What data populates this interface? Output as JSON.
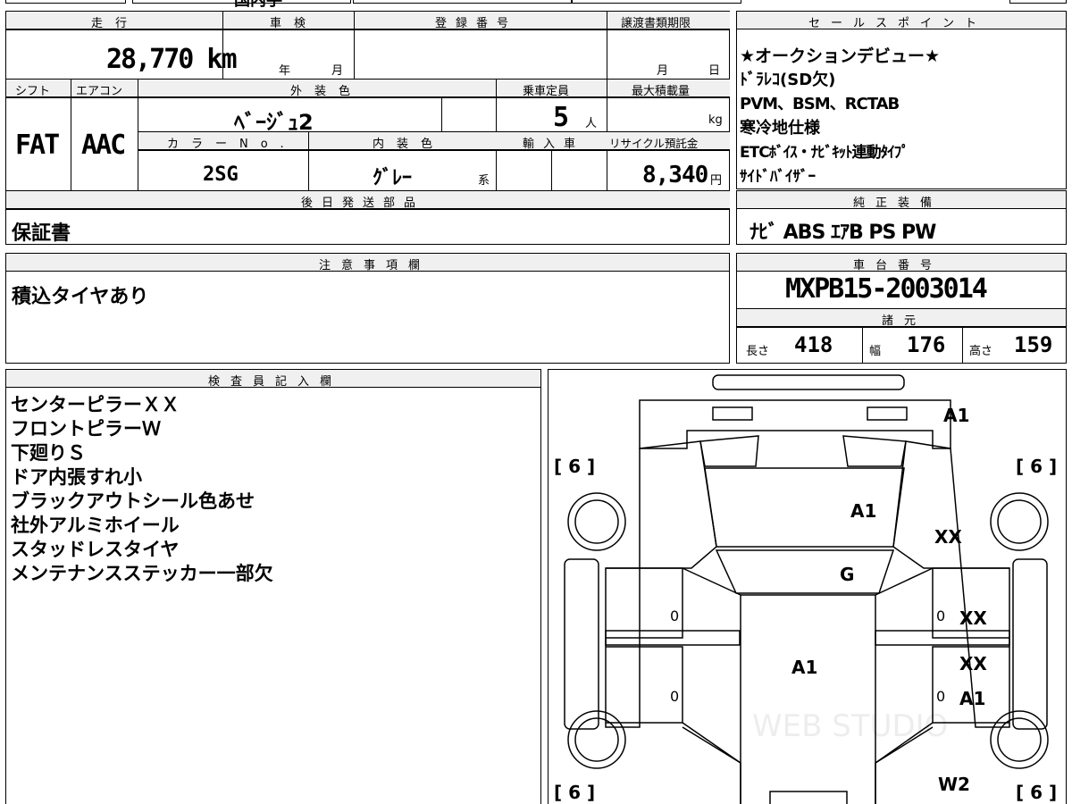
{
  "top_strip": {
    "visible_fragment": "国内手"
  },
  "mileage": {
    "header": "走行",
    "value": "28,770 km"
  },
  "inspection": {
    "header": "車検",
    "year_unit": "年",
    "month_unit": "月"
  },
  "registration": {
    "header": "登録番号"
  },
  "transfer_deadline": {
    "header": "譲渡書類期限",
    "month_unit": "月",
    "day_unit": "日"
  },
  "sales_points": {
    "header": "セールスポイント",
    "items": [
      "★オークションデビュー★",
      "ﾄﾞﾗﾚｺ(SD欠)",
      "PVM、BSM、RCTAB",
      "寒冷地仕様",
      "ETCﾎﾞｲｽ・ﾅﾋﾞｷｯﾄ連動ﾀｲﾌﾟ",
      "ｻｲﾄﾞﾊﾞｲｻﾞｰ"
    ]
  },
  "shift": {
    "header": "シフト",
    "value": "FAT"
  },
  "aircon": {
    "header": "エアコン",
    "value": "AAC"
  },
  "exterior_color": {
    "header": "外装色",
    "value": "ﾍﾞｰｼﾞｭ2"
  },
  "capacity": {
    "header": "乗車定員",
    "value": "5",
    "unit": "人"
  },
  "max_load": {
    "header": "最大積載量",
    "unit": "kg"
  },
  "color_no": {
    "header": "カラーNo.",
    "value": "2SG"
  },
  "interior_color": {
    "header": "内装色",
    "value": "ｸﾞﾚｰ",
    "suffix": "系"
  },
  "import": {
    "header": "輸入車"
  },
  "recycle": {
    "header": "リサイクル預託金",
    "value": "8,340",
    "unit": "円"
  },
  "later_parts": {
    "header": "後日発送部品",
    "value": "保証書"
  },
  "genuine_equipment": {
    "header": "純正装備",
    "value": "ﾅﾋﾞ ABS ｴｱB PS PW"
  },
  "notes": {
    "header": "注意事項欄",
    "value": "積込タイヤあり"
  },
  "chassis": {
    "header": "車台番号",
    "value": "MXPB15-2003014"
  },
  "specs": {
    "header": "諸元",
    "length_label": "長さ",
    "length": "418",
    "width_label": "幅",
    "width": "176",
    "height_label": "高さ",
    "height": "159"
  },
  "inspector": {
    "header": "検査員記入欄",
    "lines": [
      "センターピラーＸＸ",
      "フロントピラーＷ",
      "下廻りＳ",
      "ドア内張すれ小",
      "ブラックアウトシール色あせ",
      "社外アルミホイール",
      "スタッドレスタイヤ",
      "メンテナンスステッカー一部欠"
    ]
  },
  "diagram": {
    "tire_left_top": "[ 6 ]",
    "tire_right_top": "[ 6 ]",
    "tire_left_bottom": "[ 6 ]",
    "tire_right_bottom": "[ 6 ]",
    "mark_front_bumper": "A1",
    "mark_hood": "A1",
    "mark_right_fender": "XX",
    "mark_windshield": "G",
    "mark_right_front_door": "XX",
    "mark_right_rear_door_top": "XX",
    "mark_roof": "A1",
    "mark_right_rear_door": "A1",
    "mark_right_rear": "W2",
    "zero_lf": "0",
    "zero_lr": "0",
    "zero_rf": "0",
    "zero_rr": "0",
    "watermark": "WEB STUDIO"
  }
}
